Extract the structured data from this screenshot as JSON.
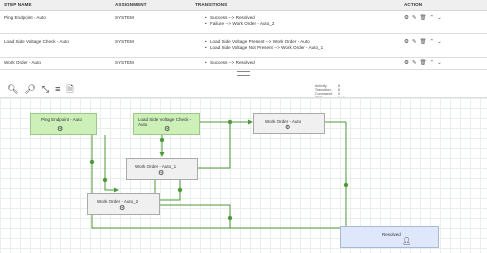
{
  "table": {
    "headers": [
      "STEP NAME",
      "ASSIGNMENT",
      "TRANSITIONS",
      "ACTION"
    ],
    "rows": [
      {
        "step": "Ping Endpoint - Auto",
        "assignment": "SYSTEM",
        "transitions": [
          "Success --> Resolved",
          "Failure --> Work Order - Auto_2"
        ]
      },
      {
        "step": "Load Side Voltage Check - Auto",
        "assignment": "SYSTEM",
        "transitions": [
          "Load Side Voltage Present --> Work Order - Auto",
          "Load Side Voltage Not Present --> Work Order - Auto_1"
        ]
      },
      {
        "step": "Work Order - Auto",
        "assignment": "SYSTEM",
        "transitions": [
          "Success --> Resolved"
        ]
      }
    ],
    "action_icons": [
      "gear-icon",
      "edit-icon",
      "trash-icon",
      "chevron-up-icon",
      "chevron-down-icon"
    ]
  },
  "toolbar": {
    "icons": [
      "zoom-in-icon",
      "zoom-out-icon",
      "fit-icon",
      "layers-icon",
      "pdf-icon"
    ]
  },
  "stats": {
    "activity_label": "Activity:",
    "activity_value": "6",
    "transition_label": "Transition:",
    "transition_value": "8",
    "command_label": "Command:",
    "command_value": "0",
    "pdf_label": "PDF pages:",
    "pdf_value": "1 / 1"
  },
  "diagram": {
    "nodes": {
      "ping": {
        "label": "Ping Endpoint - Auto"
      },
      "load": {
        "label": "Load Side Voltage Check -\nAuto"
      },
      "wo": {
        "label": "Work Order - Auto"
      },
      "wo1": {
        "label": "Work Order - Auto_1"
      },
      "wo2": {
        "label": "Work Order - Auto_2"
      },
      "resolved": {
        "label": "Resolved"
      }
    }
  },
  "colors": {
    "node_green": "#ccf0b8",
    "node_gray": "#f0f0f0",
    "node_blue": "#dfe8fa",
    "connector": "#4e9a3b"
  }
}
